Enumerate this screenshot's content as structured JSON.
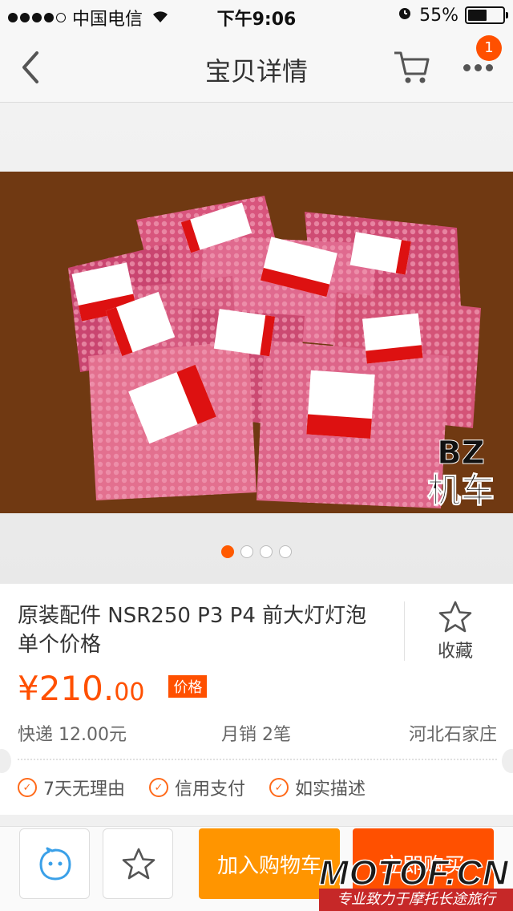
{
  "status_bar": {
    "carrier": "中国电信",
    "time": "下午9:06",
    "battery_percent": "55%",
    "battery_level": 0.55
  },
  "nav": {
    "title": "宝贝详情",
    "badge_count": "1",
    "icons": {
      "back": "chevron-left-icon",
      "cart": "cart-icon",
      "more": "more-dots-icon"
    }
  },
  "gallery": {
    "photo_text": "BZ\n机车",
    "photo_text_line1": "BZ",
    "photo_text_line2": "机车",
    "current_page": 1,
    "page_count": 4
  },
  "product": {
    "title": "原装配件 NSR250 P3 P4 前大灯灯泡 单个价格",
    "favorite_label": "收藏",
    "price_main": "¥210.",
    "price_decimal": "00",
    "price_tag": "价格",
    "shipping": "快递 12.00元",
    "monthly_sales": "月销 2笔",
    "location": "河北石家庄",
    "guarantees": [
      "7天无理由",
      "信用支付",
      "如实描述"
    ]
  },
  "bottom_bar": {
    "add_to_cart": "加入购物车",
    "buy_now": "立即购买"
  },
  "watermark": {
    "logo": "MOTOF.CN",
    "tagline": "专业致力于摩托长途旅行"
  },
  "colors": {
    "accent": "#ff5000",
    "cart_button": "#ff9500",
    "guarantee_icon": "#ff6a1a"
  }
}
